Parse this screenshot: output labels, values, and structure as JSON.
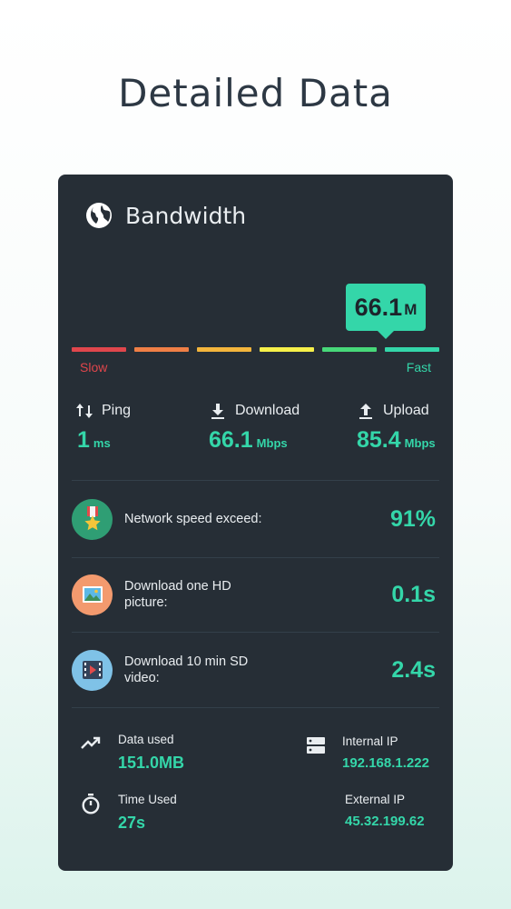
{
  "headline": "Detailed Data",
  "card": {
    "title": "Bandwidth",
    "globe_icon": "globe-icon"
  },
  "speed": {
    "value": "66.1",
    "unit": "M",
    "slow_label": "Slow",
    "fast_label": "Fast",
    "segment_colors": [
      "#e0464c",
      "#ef7f46",
      "#f3b53c",
      "#f6f04a",
      "#47d879",
      "#34d6a9"
    ]
  },
  "stats": {
    "ping": {
      "label": "Ping",
      "value": "1",
      "unit": "ms"
    },
    "download": {
      "label": "Download",
      "value": "66.1",
      "unit": "Mbps"
    },
    "upload": {
      "label": "Upload",
      "value": "85.4",
      "unit": "Mbps"
    }
  },
  "metrics": [
    {
      "label": "Network speed exceed:",
      "value": "91%",
      "icon": "medal-icon",
      "color": "#2f9e74"
    },
    {
      "label": "Download one HD picture:",
      "value": "0.1s",
      "icon": "picture-icon",
      "color": "#f39a6e"
    },
    {
      "label": "Download 10 min SD video:",
      "value": "2.4s",
      "icon": "video-icon",
      "color": "#7fc2e7"
    }
  ],
  "info": {
    "data_used": {
      "label": "Data used",
      "value": "151.0MB"
    },
    "time_used": {
      "label": "Time Used",
      "value": "27s"
    },
    "internal_ip": {
      "label": "Internal IP",
      "value": "192.168.1.222"
    },
    "external_ip": {
      "label": "External IP",
      "value": "45.32.199.62"
    }
  },
  "accent": "#34d6a9"
}
